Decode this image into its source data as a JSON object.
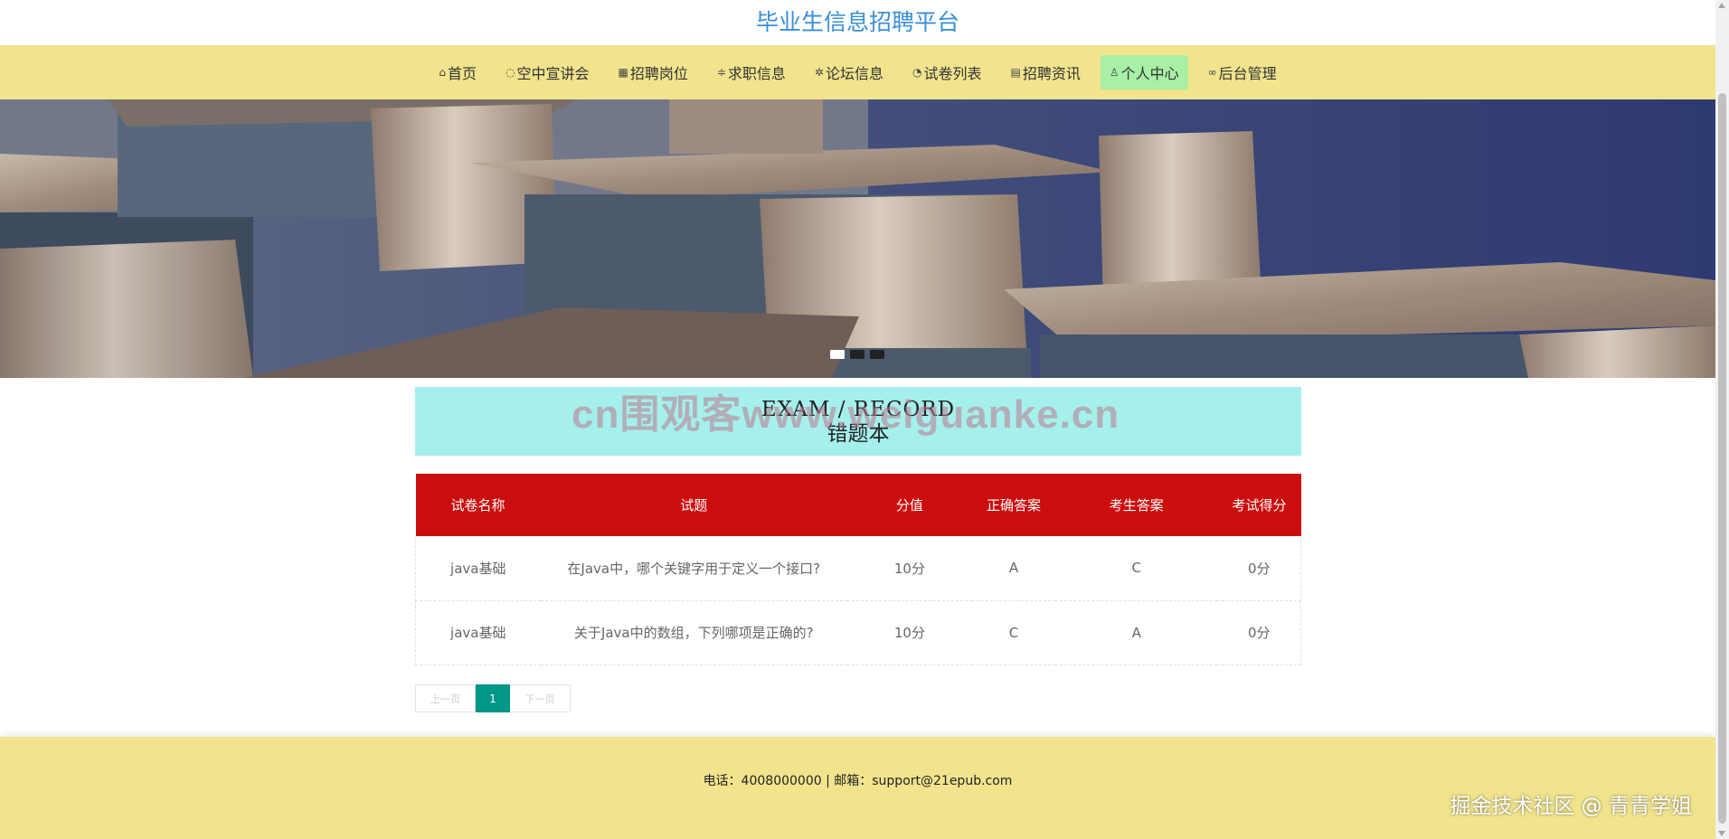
{
  "site": {
    "title": "毕业生信息招聘平台"
  },
  "nav": [
    {
      "label": "首页",
      "icon": "home-icon",
      "glyph": "⌂"
    },
    {
      "label": "空中宣讲会",
      "icon": "palette-icon",
      "glyph": "◌"
    },
    {
      "label": "招聘岗位",
      "icon": "briefcase-icon",
      "glyph": "▦"
    },
    {
      "label": "求职信息",
      "icon": "filter-icon",
      "glyph": "≑"
    },
    {
      "label": "论坛信息",
      "icon": "gear-icon",
      "glyph": "✲"
    },
    {
      "label": "试卷列表",
      "icon": "gauge-icon",
      "glyph": "◔"
    },
    {
      "label": "招聘资讯",
      "icon": "news-icon",
      "glyph": "▤"
    },
    {
      "label": "个人中心",
      "icon": "user-icon",
      "glyph": "♙"
    },
    {
      "label": "后台管理",
      "icon": "link-icon",
      "glyph": "∞"
    }
  ],
  "section": {
    "title_en": "EXAM / RECORD",
    "title_cn": "错题本",
    "overlay_watermark": "cn围观客www.weiguanke.cn"
  },
  "table": {
    "headers": [
      "试卷名称",
      "试题",
      "分值",
      "正确答案",
      "考生答案",
      "考试得分"
    ],
    "rows": [
      [
        "java基础",
        "在Java中，哪个关键字用于定义一个接口?",
        "10分",
        "A",
        "C",
        "0分"
      ],
      [
        "java基础",
        "关于Java中的数组，下列哪项是正确的?",
        "10分",
        "C",
        "A",
        "0分"
      ]
    ]
  },
  "pagination": {
    "prev": "上一页",
    "current": "1",
    "next": "下一页"
  },
  "footer": {
    "text": "电话：4008000000 | 邮箱：support@21epub.com"
  },
  "corner_watermark": "掘金技术社区 @ 青青学姐",
  "colors": {
    "title": "#3a8fd8",
    "nav_bg": "#f1e48c",
    "nav_active": "#a8f0a6",
    "section_bg": "#a5f0ec",
    "table_header": "#cc0d0d",
    "page_current": "#009688"
  }
}
